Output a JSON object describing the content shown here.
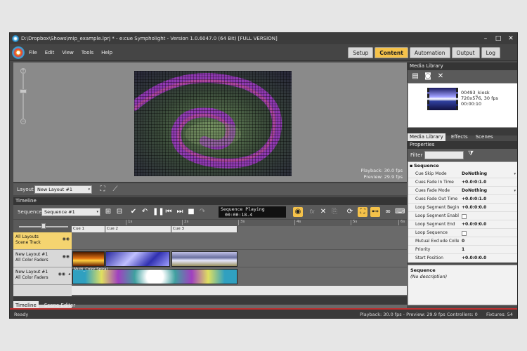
{
  "window": {
    "title": "D:\\Dropbox\\Shows\\mip_example.lprj * - e:cue Sympholight - Version 1.0.6047.0 (64 Bit) [FULL VERSION]",
    "controls": [
      "–",
      "□",
      "✕"
    ]
  },
  "menu": [
    "File",
    "Edit",
    "View",
    "Tools",
    "Help"
  ],
  "mode_tabs": [
    {
      "label": "Setup",
      "active": false
    },
    {
      "label": "Content",
      "active": true
    },
    {
      "label": "Automation",
      "active": false
    },
    {
      "label": "Output",
      "active": false
    },
    {
      "label": "Log",
      "active": false
    }
  ],
  "viewer": {
    "zoom_plus": "+",
    "zoom_minus": "−",
    "playback_line": "Playback: 30.0 fps",
    "preview_line": "Preview: 29.9 fps"
  },
  "layout_bar": {
    "label": "Layout",
    "selected": "New Layout #1",
    "dropdown_arrow": "▾",
    "fit_icon": "⛶",
    "wand_icon": "⟋"
  },
  "timeline": {
    "title": "Timeline",
    "sequence_label": "Sequence",
    "sequence_selected": "Sequence #1",
    "dropdown_arrow": "▾",
    "status_line1": "Sequence Playing",
    "status_line2": "00:00:18.4",
    "toolbar_icons": {
      "add": "⊞",
      "save": "⊟",
      "check": "✔",
      "undo": "↶",
      "pause": "❚❚",
      "prev": "⏮",
      "next": "⏭",
      "stop": "■",
      "redo": "↷",
      "eye": "◉",
      "fx": "fx",
      "delete": "✕",
      "copy": "⎘",
      "loop": "⟳",
      "fit": "⛶",
      "snap": "⊷",
      "glasses": "∞",
      "keyboard": "⌨"
    },
    "ruler_ticks": [
      "1s",
      "2s",
      "3s",
      "4s",
      "5s",
      "6s"
    ],
    "cues": [
      "Cue 1",
      "Cue 2",
      "Cue 3"
    ],
    "tracks": [
      {
        "line1": "All Layouts",
        "line2": "Scene Track"
      },
      {
        "line1": "New Layout #1",
        "line2": "All Color Faders"
      },
      {
        "line1": "New Layout #1",
        "line2": "All Color Faders"
      }
    ],
    "visibility_icon": "◉◉",
    "collapse_icon": "◂",
    "clip_label": "Multi_Color Spiral"
  },
  "bottom_tabs": [
    {
      "label": "Timeline",
      "active": true
    },
    {
      "label": "Scene Editor",
      "active": false
    }
  ],
  "media_library": {
    "title": "Media Library",
    "icons": {
      "folder": "▤",
      "camera": "◙",
      "delete": "✕"
    },
    "item": {
      "name": "00493_kiosk",
      "spec": "720x576, 30 fps",
      "duration": "00:00:10"
    },
    "tabs": [
      {
        "label": "Media Library",
        "active": true
      },
      {
        "label": "Effects",
        "active": false
      },
      {
        "label": "Scenes",
        "active": false
      }
    ]
  },
  "properties": {
    "title": "Properties",
    "filter_label": "Filter",
    "filter_placeholder": "",
    "filter_icon": "⧩",
    "group": "Sequence",
    "group_toggle": "▪",
    "dropdown_arrow": "▾",
    "rows": [
      {
        "key": "Cue Skip Mode",
        "value": "DoNothing",
        "type": "dropdown"
      },
      {
        "key": "Cues Fade In Time",
        "value": "+0.0:0:1.0",
        "type": "text"
      },
      {
        "key": "Cues Fade Mode",
        "value": "DoNothing",
        "type": "dropdown"
      },
      {
        "key": "Cues Fade Out Time",
        "value": "+0.0:0:1.0",
        "type": "text"
      },
      {
        "key": "Loop Segment Begin",
        "value": "+0.0:0:0.0",
        "type": "text"
      },
      {
        "key": "Loop Segment Enabled",
        "value": "",
        "type": "checkbox"
      },
      {
        "key": "Loop Segment End",
        "value": "+0.0:0:0.0",
        "type": "text"
      },
      {
        "key": "Loop Sequence",
        "value": "",
        "type": "checkbox"
      },
      {
        "key": "Mutual Exclude Collection",
        "value": "0",
        "type": "text"
      },
      {
        "key": "Priority",
        "value": "1",
        "type": "text"
      },
      {
        "key": "Start Position",
        "value": "+0.0:0:0.0",
        "type": "text"
      }
    ]
  },
  "description": {
    "title": "Sequence",
    "text": "(No description)"
  },
  "statusbar": {
    "left": "Ready",
    "playback": "Playback: 30.0 fps - Preview: 29.9 fps",
    "controllers": "Controllers: 0",
    "fixtures": "Fixtures: 54"
  },
  "colors": {
    "accent": "#f5c24a",
    "status_border": "#c03030",
    "chrome": "#4a4a4a"
  }
}
